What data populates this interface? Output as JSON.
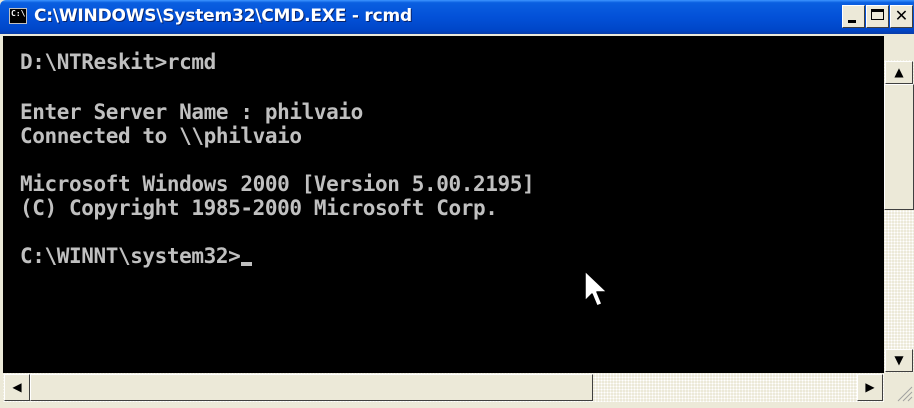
{
  "window": {
    "title": "C:\\WINDOWS\\System32\\CMD.EXE - rcmd",
    "icon": "cmd-console-icon",
    "icon_text": "C:\\",
    "controls": [
      "minimize-icon",
      "maximize-icon",
      "close-icon"
    ]
  },
  "console": {
    "lines": [
      "D:\\NTReskit>rcmd",
      "Enter Server Name : philvaio",
      "Connected to \\\\philvaio",
      "Microsoft Windows 2000 [Version 5.00.2195]",
      "(C) Copyright 1985-2000 Microsoft Corp.",
      "C:\\WINNT\\system32>"
    ],
    "colors": {
      "background": "#000000",
      "text": "#c0c0c0"
    }
  },
  "scrollbars": {
    "up_arrow": "▲",
    "down_arrow": "▼",
    "left_arrow": "◀",
    "right_arrow": "▶"
  },
  "colors": {
    "titlebar": "#0351d8",
    "chrome": "#ece9d8"
  }
}
